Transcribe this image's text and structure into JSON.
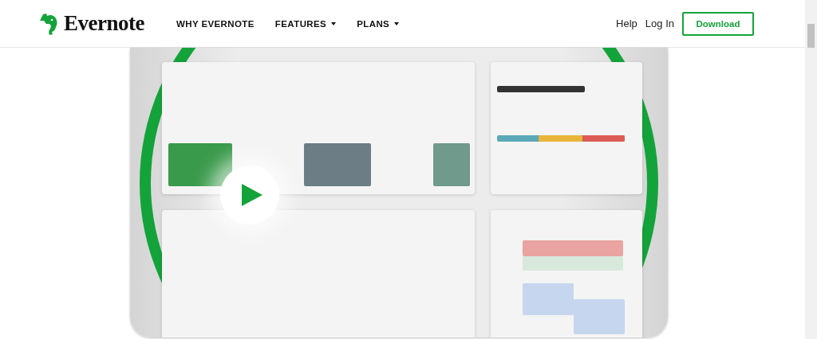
{
  "header": {
    "logo": "Evernote",
    "nav": [
      {
        "label": "WHY EVERNOTE",
        "dropdown": false
      },
      {
        "label": "FEATURES",
        "dropdown": true
      },
      {
        "label": "PLANS",
        "dropdown": true
      }
    ],
    "links": [
      "Help",
      "Log In"
    ],
    "cta": "Download"
  }
}
